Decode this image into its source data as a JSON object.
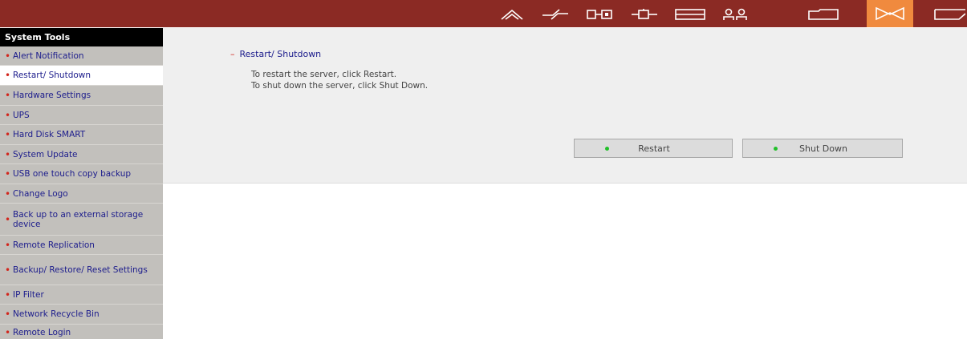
{
  "topbar": {
    "icons": [
      "home-icon",
      "network-icon",
      "device-icon",
      "adapter-icon",
      "server-icon",
      "users-icon",
      "share-icon",
      "system-tools-icon",
      "log-icon"
    ],
    "active_icon": "system-tools-icon",
    "bar_color": "#8b2a24",
    "active_color": "#f08a3e"
  },
  "sidebar": {
    "title": "System Tools",
    "items": [
      {
        "label": "Alert Notification"
      },
      {
        "label": "Restart/ Shutdown",
        "selected": true
      },
      {
        "label": "Hardware Settings"
      },
      {
        "label": "UPS"
      },
      {
        "label": "Hard Disk SMART"
      },
      {
        "label": "System Update"
      },
      {
        "label": "USB one touch copy backup"
      },
      {
        "label": "Change Logo"
      },
      {
        "label": "Back up to an external storage device"
      },
      {
        "label": "Remote Replication"
      },
      {
        "label": "Backup/ Restore/ Reset Settings"
      },
      {
        "label": "IP Filter"
      },
      {
        "label": "Network Recycle Bin"
      },
      {
        "label": "Remote Login"
      }
    ]
  },
  "main": {
    "section_dash": "–",
    "section_title": "Restart/ Shutdown",
    "desc_restart": "To restart the server, click Restart.",
    "desc_shutdown": "To shut down the server, click Shut Down.",
    "restart_label": "Restart",
    "shutdown_label": "Shut Down"
  }
}
